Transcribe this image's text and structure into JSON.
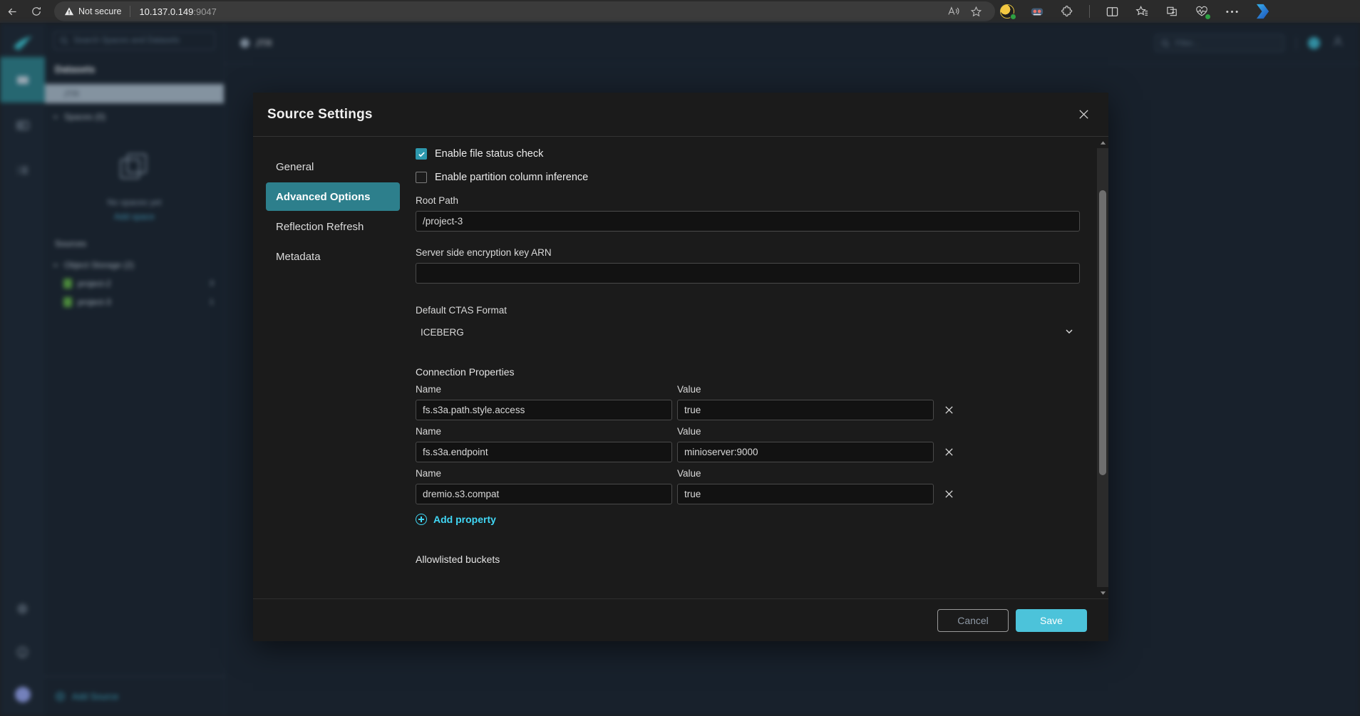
{
  "browser": {
    "back_icon": "back-arrow-icon",
    "reload_icon": "reload-icon",
    "security_label": "Not secure",
    "url_host": "10.137.0.149",
    "url_port": ":9047",
    "read_aloud_icon": "read-aloud-icon",
    "favorite_icon": "star-icon",
    "toolbar_icons": [
      "profile-badge-icon",
      "extension-avatar-icon",
      "extensions-puzzle-icon",
      "split-screen-icon",
      "collections-star-icon",
      "browser-essentials-icon",
      "performance-heart-icon",
      "more-settings-icon",
      "copilot-icon"
    ]
  },
  "app": {
    "logo": "dremio-logo-icon",
    "rail": [
      {
        "name": "datasets-rail-item",
        "icon": "dataset-icon",
        "active": true
      },
      {
        "name": "jobs-rail-item",
        "icon": "jobs-icon",
        "active": false
      },
      {
        "name": "sql-runner-rail-item",
        "icon": "list-icon",
        "active": false
      }
    ],
    "rail_bottom": [
      {
        "name": "settings-rail-item",
        "icon": "gear-icon"
      },
      {
        "name": "help-rail-item",
        "icon": "help-circle-icon"
      },
      {
        "name": "account-rail-item",
        "icon": "avatar-icon"
      }
    ],
    "search": {
      "placeholder": "Search Spaces and Datasets",
      "icon": "search-icon"
    },
    "sidebar": {
      "title": "Datasets",
      "selected_item": "JTR",
      "spaces_group": "Spaces (0)",
      "empty_state_caption": "No spaces yet",
      "empty_state_link": "Add space",
      "sources_title": "Sources",
      "object_storage_group": "Object Storage (2)",
      "sources": [
        {
          "label": "project-2",
          "count": "3"
        },
        {
          "label": "project-3",
          "count": "1"
        }
      ],
      "add_source": "Add Source"
    },
    "main": {
      "breadcrumb": "JTR",
      "filter_placeholder": "Filter..."
    }
  },
  "modal": {
    "title": "Source Settings",
    "close_icon": "close-icon",
    "tabs": [
      {
        "label": "General",
        "active": false
      },
      {
        "label": "Advanced Options",
        "active": true
      },
      {
        "label": "Reflection Refresh",
        "active": false
      },
      {
        "label": "Metadata",
        "active": false
      }
    ],
    "checkboxes": [
      {
        "label": "Enable file status check",
        "checked": true
      },
      {
        "label": "Enable partition column inference",
        "checked": false
      }
    ],
    "root_path": {
      "label": "Root Path",
      "value": "/project-3"
    },
    "sse_key": {
      "label": "Server side encryption key ARN",
      "value": ""
    },
    "ctas": {
      "label": "Default CTAS Format",
      "value": "ICEBERG",
      "chevron": "chevron-down-icon"
    },
    "connection_properties": {
      "section_title": "Connection Properties",
      "name_label": "Name",
      "value_label": "Value",
      "remove_icon": "close-icon",
      "rows": [
        {
          "name": "fs.s3a.path.style.access",
          "value": "true"
        },
        {
          "name": "fs.s3a.endpoint",
          "value": "minioserver:9000"
        },
        {
          "name": "dremio.s3.compat",
          "value": "true"
        }
      ],
      "add_property": "Add property",
      "add_icon": "plus-circle-icon"
    },
    "allowlisted_buckets": "Allowlisted buckets",
    "footer": {
      "cancel": "Cancel",
      "save": "Save"
    }
  },
  "colors": {
    "accent_teal": "#2d7f8c",
    "save_blue": "#4cc3da",
    "link_cyan": "#41d7f5",
    "checkbox_teal": "#2d98ad"
  }
}
